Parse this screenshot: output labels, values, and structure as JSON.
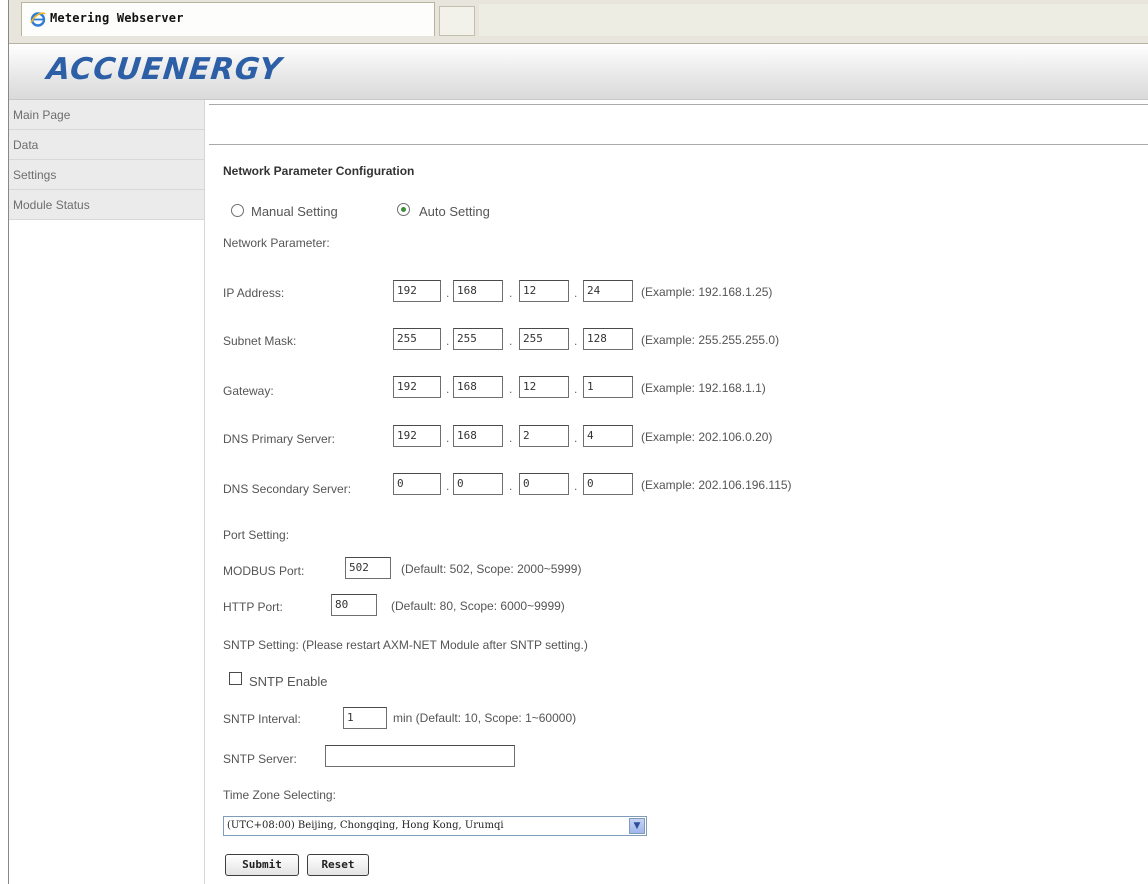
{
  "browser": {
    "tab_title": "Metering Webserver"
  },
  "header": {
    "logo_text": "ACCUENERGY"
  },
  "sidebar": {
    "items": [
      {
        "label": "Main Page"
      },
      {
        "label": "Data"
      },
      {
        "label": "Settings"
      },
      {
        "label": "Module Status"
      }
    ]
  },
  "form": {
    "title": "Network Parameter Configuration",
    "mode": {
      "manual_label": "Manual Setting",
      "auto_label": "Auto Setting",
      "selected": "auto"
    },
    "network_section_label": "Network Parameter:",
    "ip": {
      "label": "IP Address:",
      "octets": [
        "192",
        "168",
        "12",
        "24"
      ],
      "example": "(Example: 192.168.1.25)"
    },
    "subnet": {
      "label": "Subnet Mask:",
      "octets": [
        "255",
        "255",
        "255",
        "128"
      ],
      "example": "(Example: 255.255.255.0)"
    },
    "gateway": {
      "label": "Gateway:",
      "octets": [
        "192",
        "168",
        "12",
        "1"
      ],
      "example": "(Example: 192.168.1.1)"
    },
    "dns1": {
      "label": "DNS Primary Server:",
      "octets": [
        "192",
        "168",
        "2",
        "4"
      ],
      "example": "(Example: 202.106.0.20)"
    },
    "dns2": {
      "label": "DNS Secondary Server:",
      "octets": [
        "0",
        "0",
        "0",
        "0"
      ],
      "example": "(Example: 202.106.196.115)"
    },
    "port_section_label": "Port Setting:",
    "modbus": {
      "label": "MODBUS Port:",
      "value": "502",
      "hint": "(Default: 502, Scope: 2000~5999)"
    },
    "http": {
      "label": "HTTP Port:",
      "value": "80",
      "hint": "(Default: 80, Scope: 6000~9999)"
    },
    "sntp_section_label": "SNTP Setting: (Please restart AXM-NET Module after SNTP setting.)",
    "sntp_enable_label": "SNTP Enable",
    "sntp_enabled": false,
    "sntp_interval": {
      "label": "SNTP Interval:",
      "value": "1",
      "hint": "min (Default: 10, Scope: 1~60000)"
    },
    "sntp_server": {
      "label": "SNTP Server:",
      "value": ""
    },
    "timezone_label": "Time Zone Selecting:",
    "timezone_value": "(UTC+08:00) Beijing, Chongqing, Hong Kong, Urumqi",
    "submit_label": "Submit",
    "reset_label": "Reset"
  }
}
